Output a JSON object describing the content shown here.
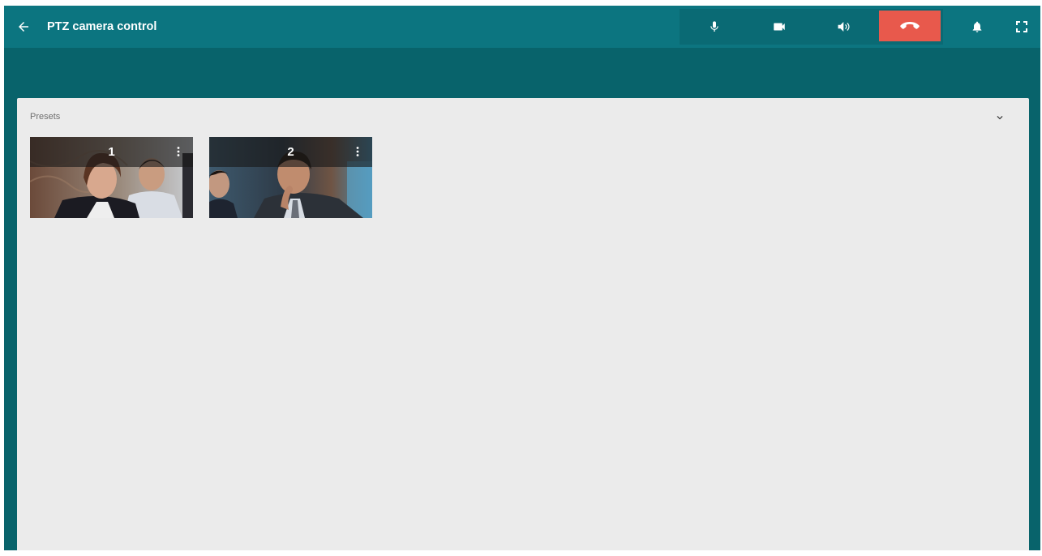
{
  "header": {
    "title": "PTZ camera control",
    "back_icon": "arrow-left-icon"
  },
  "call_controls": {
    "icons": [
      "microphone-icon",
      "videocam-icon",
      "speaker-volume-icon",
      "hang-up-phone-icon"
    ],
    "hangup_color": "#e8594c"
  },
  "right_icons": [
    "bell-icon",
    "fullscreen-icon"
  ],
  "colors": {
    "topbar": "#0c7580",
    "background": "#08636b",
    "panel": "#ebebeb"
  },
  "presets_panel": {
    "title": "Presets",
    "collapse_icon": "chevron-down-icon",
    "presets": [
      {
        "number": "1",
        "menu_icon": "more-vertical-icon"
      },
      {
        "number": "2",
        "menu_icon": "more-vertical-icon"
      }
    ]
  }
}
